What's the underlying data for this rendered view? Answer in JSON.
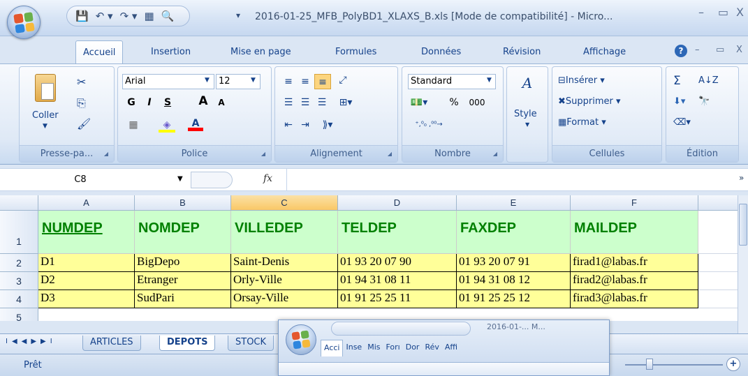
{
  "window": {
    "title": "2016-01-25_MFB_PolyBD1_XLAXS_B.xls  [Mode de compatibilité] - Micro...",
    "minimize": "–",
    "maximize": "▭",
    "close": "X"
  },
  "quick_access": {
    "save": "💾",
    "undo": "↶ ▾",
    "redo": "↷ ▾",
    "form": "▦",
    "preview": "🔍",
    "customize": "▾"
  },
  "tabs": [
    {
      "label": "Accueil",
      "active": true
    },
    {
      "label": "Insertion"
    },
    {
      "label": "Mise en page"
    },
    {
      "label": "Formules"
    },
    {
      "label": "Données"
    },
    {
      "label": "Révision"
    },
    {
      "label": "Affichage"
    }
  ],
  "tab_controls": {
    "help": "?",
    "minimize": "–",
    "restore": "▭",
    "close": "X"
  },
  "ribbon": {
    "clipboard": {
      "label": "Presse-pa...",
      "paste": "Coller",
      "cut": "✂",
      "copy": "⎘",
      "painter": "🖌"
    },
    "font": {
      "label": "Police",
      "name": "Arial",
      "size": "12",
      "bold": "G",
      "italic": "I",
      "underline": "S",
      "grow": "A",
      "shrink": "A",
      "border": "▦",
      "fill": "◈",
      "color": "A"
    },
    "alignment": {
      "label": "Alignement"
    },
    "number": {
      "label": "Nombre",
      "format": "Standard",
      "percent": "%",
      "thousands": "000",
      "inc_dec": "←,0 ,00",
      "dec_dec": ",00 →,0"
    },
    "style": {
      "label": "Style"
    },
    "cells": {
      "label": "Cellules",
      "insert": "Insérer",
      "delete": "Supprimer",
      "format": "Format"
    },
    "editing": {
      "label": "Édition",
      "sum": "Σ",
      "sort": "A↓Z",
      "find": "🔭"
    }
  },
  "formula_bar": {
    "name_box": "C8",
    "fx": "fx",
    "value": ""
  },
  "columns": [
    "A",
    "B",
    "C",
    "D",
    "E",
    "F"
  ],
  "selected_column": "C",
  "rows": [
    "1",
    "2",
    "3",
    "4",
    "5"
  ],
  "table": {
    "headers": [
      "NUMDEP",
      "NOMDEP",
      "VILLEDEP",
      "TELDEP",
      "FAXDEP",
      "MAILDEP"
    ],
    "data": [
      [
        "D1",
        "BigDepo",
        "Saint-Denis",
        "01 93 20 07 90",
        "01 93 20 07 91",
        "firad1@labas.fr"
      ],
      [
        "D2",
        "Etranger",
        "Orly-Ville",
        "01 94 31 08 11",
        "01 94 31 08 12",
        "firad2@labas.fr"
      ],
      [
        "D3",
        "SudPari",
        "Orsay-Ville",
        "01 91 25 25 11",
        "01 91 25 25 12",
        "firad3@labas.fr"
      ]
    ]
  },
  "sheets": [
    {
      "label": "ARTICLES"
    },
    {
      "label": "DEPOTS",
      "active": true
    },
    {
      "label": "STOCK"
    }
  ],
  "sheet_nav": {
    "first": "I◀",
    "prev": "◀",
    "next": "▶",
    "last": "▶I"
  },
  "status": {
    "text": "Prêt"
  },
  "mini_window": {
    "title": "2016-01-... M...",
    "tabs": [
      "Acci",
      "Inse",
      "Mis",
      "Forı",
      "Dor",
      "Rév",
      "Affi"
    ]
  },
  "colors": {
    "header_fill": "#ccffcc",
    "header_text": "#008000",
    "data_fill": "#ffff99",
    "selected_col": "#f9c866"
  }
}
